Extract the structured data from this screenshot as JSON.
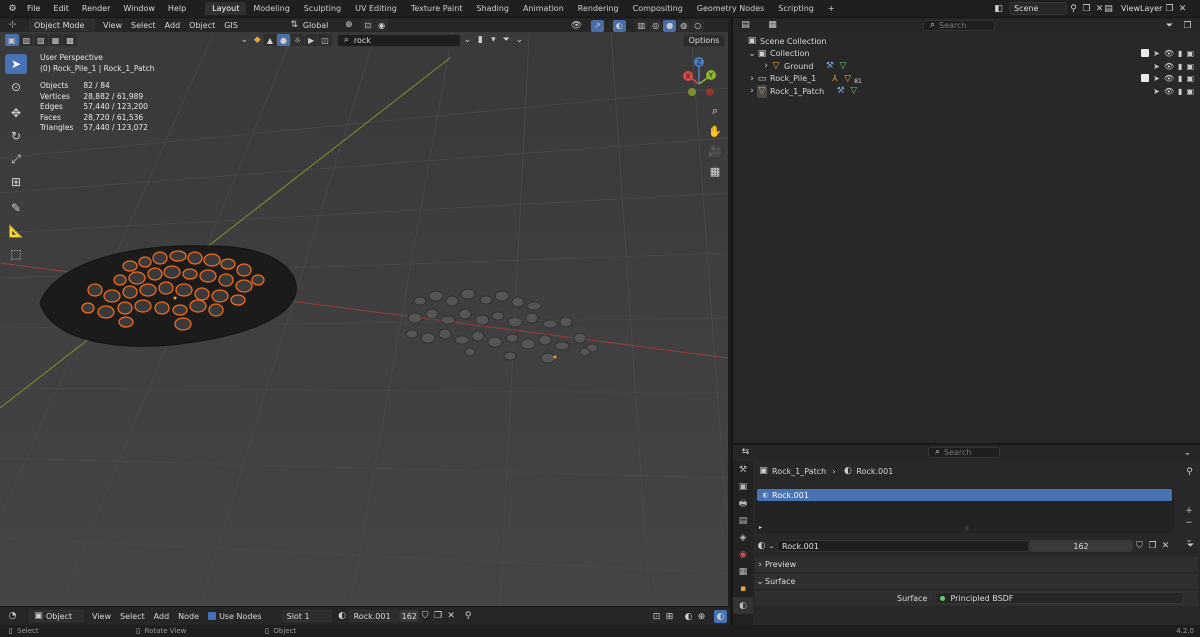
{
  "topbar": {
    "menus": [
      "File",
      "Edit",
      "Render",
      "Window",
      "Help"
    ],
    "workspaces": [
      "Layout",
      "Modeling",
      "Sculpting",
      "UV Editing",
      "Texture Paint",
      "Shading",
      "Animation",
      "Rendering",
      "Compositing",
      "Geometry Nodes",
      "Scripting"
    ],
    "add_tab": "+",
    "scene": "Scene",
    "view_layer": "ViewLayer"
  },
  "viewport": {
    "mode": "Object Mode",
    "menus": [
      "View",
      "Select",
      "Add",
      "Object",
      "GIS"
    ],
    "orientation": "Global",
    "filter_text": "rock",
    "options_label": "Options",
    "overlay_title": "User Perspective",
    "overlay_subtitle": "(0) Rock_Pile_1 | Rock_1_Patch",
    "stats": [
      {
        "label": "Objects",
        "value": "82 / 84"
      },
      {
        "label": "Vertices",
        "value": "28,882 / 61,989"
      },
      {
        "label": "Edges",
        "value": "57,440 / 123,200"
      },
      {
        "label": "Faces",
        "value": "28,720 / 61,536"
      },
      {
        "label": "Triangles",
        "value": "57,440 / 123,072"
      }
    ],
    "gizmo": {
      "z": "Z",
      "y": "Y",
      "x": "X"
    }
  },
  "footer": {
    "editor": "Object",
    "menus": [
      "View",
      "Select",
      "Add",
      "Node"
    ],
    "use_nodes": "Use Nodes",
    "slot": "Slot 1",
    "material": "Rock.001",
    "users": "162"
  },
  "statusbar": {
    "select": "Select",
    "rotate": "Rotate View",
    "object": "Object",
    "version": "4.2.0"
  },
  "outliner": {
    "search_placeholder": "Search",
    "root": "Scene Collection",
    "items": [
      {
        "name": "Collection"
      },
      {
        "name": "Ground"
      },
      {
        "name": "Rock_Pile_1",
        "badge": "81"
      },
      {
        "name": "Rock_1_Patch"
      }
    ]
  },
  "properties": {
    "search_placeholder": "Search",
    "breadcrumb_object": "Rock_1_Patch",
    "breadcrumb_material": "Rock.001",
    "slot_item": "Rock.001",
    "material_name": "Rock.001",
    "users": "162",
    "preview_label": "Preview",
    "surface_label": "Surface",
    "surface_field_label": "Surface",
    "surface_value": "Principled BSDF"
  },
  "colors": {
    "accent": "#4772b3",
    "selection": "#f2691c",
    "viewport_bg": "#3d3d3d",
    "panel_bg": "#282828"
  }
}
